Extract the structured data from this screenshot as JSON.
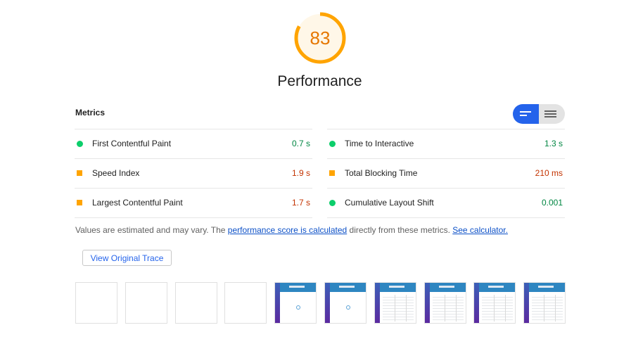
{
  "score": {
    "value": "83",
    "fraction": 0.83,
    "color": "#ffa400",
    "title": "Performance"
  },
  "metrics": {
    "heading": "Metrics",
    "left": [
      {
        "status": "pass",
        "label": "First Contentful Paint",
        "value": "0.7 s"
      },
      {
        "status": "average",
        "label": "Speed Index",
        "value": "1.9 s"
      },
      {
        "status": "average",
        "label": "Largest Contentful Paint",
        "value": "1.7 s"
      }
    ],
    "right": [
      {
        "status": "pass",
        "label": "Time to Interactive",
        "value": "1.3 s"
      },
      {
        "status": "average",
        "label": "Total Blocking Time",
        "value": "210 ms"
      },
      {
        "status": "pass",
        "label": "Cumulative Layout Shift",
        "value": "0.001"
      }
    ],
    "toggle_icons": [
      "compact-view-icon",
      "expanded-view-icon"
    ]
  },
  "note": {
    "prefix": "Values are estimated and may vary. The ",
    "link1": "performance score is calculated",
    "middle": " directly from these metrics. ",
    "link2": "See calculator."
  },
  "trace_button": "View Original Trace",
  "filmstrip": {
    "frames": [
      "blank",
      "blank",
      "blank",
      "blank",
      "loading",
      "loading",
      "loaded",
      "loaded",
      "loaded",
      "loaded"
    ]
  },
  "colors": {
    "pass": "#0cce6b",
    "average": "#ffa400",
    "accent": "#2463eb"
  }
}
